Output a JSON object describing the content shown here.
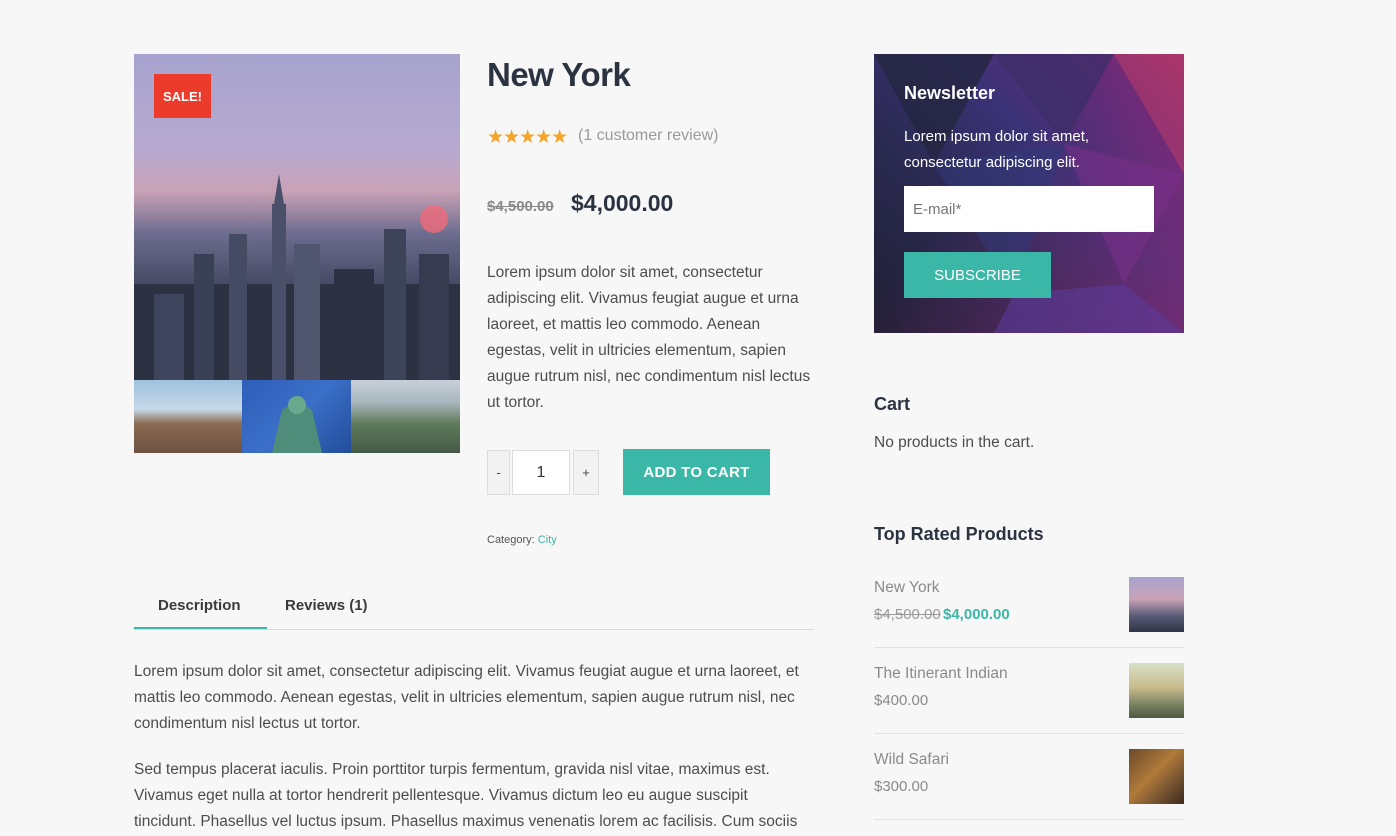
{
  "gallery": {
    "sale_badge": "SALE!",
    "main_image": "new-york-skyline-photo",
    "thumbnails": [
      "manhattan-buildings-photo",
      "statue-of-liberty-photo",
      "central-park-photo"
    ]
  },
  "product": {
    "title": "New York",
    "rating_stars": "★★★★★",
    "rating": 5,
    "review_link": "(1 customer review)",
    "old_price": "$4,500.00",
    "price": "$4,000.00",
    "short_description": "Lorem ipsum dolor sit amet, consectetur adipiscing elit. Vivamus feugiat augue et urna laoreet, et mattis leo commodo. Aenean egestas, velit in ultricies elementum, sapien augue rutrum nisl, nec condimentum nisl lectus ut tortor.",
    "qty_minus": "-",
    "qty_value": "1",
    "qty_plus": "+",
    "add_to_cart": "ADD TO CART",
    "category_label": "Category:",
    "category_value": "City"
  },
  "tabs": {
    "description": "Description",
    "reviews": "Reviews (1)",
    "active": "Description"
  },
  "description": {
    "p1": "Lorem ipsum dolor sit amet, consectetur adipiscing elit. Vivamus feugiat augue et urna laoreet, et mattis leo commodo. Aenean egestas, velit in ultricies elementum, sapien augue rutrum nisl, nec condimentum nisl lectus ut tortor.",
    "p2": "Sed tempus placerat iaculis. Proin porttitor turpis fermentum, gravida nisl vitae, maximus est. Vivamus eget nulla at tortor hendrerit pellentesque. Vivamus dictum leo eu augue suscipit tincidunt. Phasellus vel luctus ipsum. Phasellus maximus venenatis lorem ac facilisis. Cum sociis"
  },
  "newsletter": {
    "title": "Newsletter",
    "text": "Lorem ipsum dolor sit amet, consectetur adipiscing elit.",
    "email_placeholder": "E-mail*",
    "button": "SUBSCRIBE"
  },
  "cart": {
    "title": "Cart",
    "empty_text": "No products in the cart."
  },
  "top_rated": {
    "title": "Top Rated Products",
    "items": [
      {
        "name": "New York",
        "old_price": "$4,500.00",
        "price": "$4,000.00"
      },
      {
        "name": "The Itinerant Indian",
        "price": "$400.00"
      },
      {
        "name": "Wild Safari",
        "price": "$300.00"
      }
    ]
  },
  "colors": {
    "accent": "#3bb7a7",
    "sale": "#ec3a2b",
    "stars": "#f2a42b",
    "heading": "#2c3340"
  }
}
